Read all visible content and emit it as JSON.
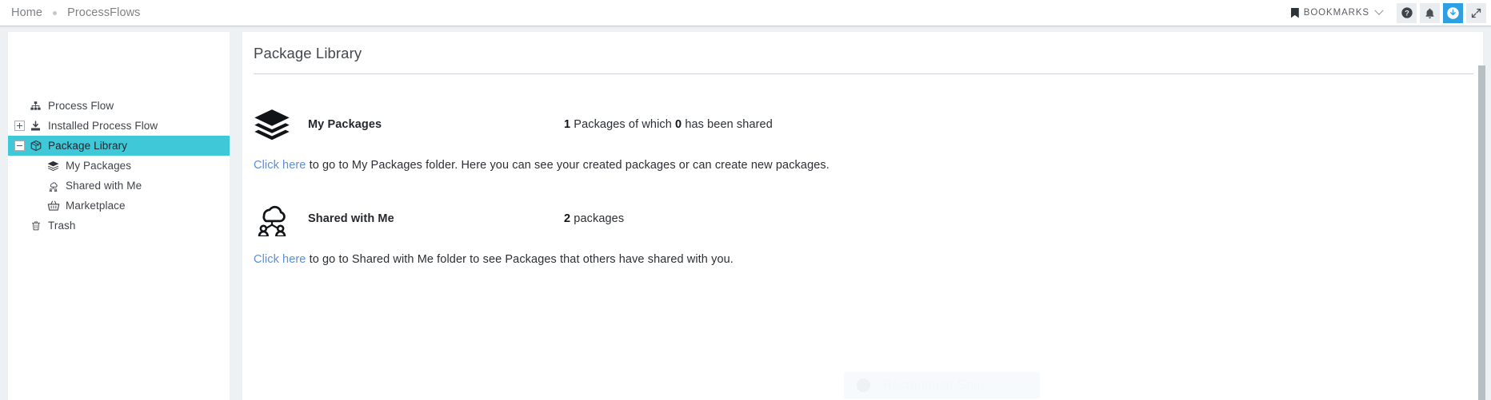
{
  "topbar": {
    "breadcrumb": [
      {
        "label": "Home"
      },
      {
        "label": "ProcessFlows"
      }
    ],
    "bookmarks_label": "BOOKMARKS",
    "buttons": [
      {
        "name": "help-button",
        "icon": "help-icon",
        "active": false
      },
      {
        "name": "notifications-button",
        "icon": "bell-icon",
        "active": false
      },
      {
        "name": "downloads-button",
        "icon": "download-circle-icon",
        "active": true
      },
      {
        "name": "fullscreen-button",
        "icon": "expand-arrows-icon",
        "active": false
      }
    ],
    "accent_color": "#2e9fe0",
    "button_bg": "#eaedf0"
  },
  "sidebar": {
    "highlight_color": "#3ec8d8",
    "items": [
      {
        "label": "Process Flow",
        "icon": "sitemap-icon",
        "toggle": "none",
        "level": 1,
        "selected": false
      },
      {
        "label": "Installed Process Flow",
        "icon": "install-icon",
        "toggle": "plus",
        "level": 1,
        "selected": false
      },
      {
        "label": "Package Library",
        "icon": "package-box-icon",
        "toggle": "minus",
        "level": 1,
        "selected": true
      },
      {
        "label": "My Packages",
        "icon": "layers-icon",
        "toggle": "none",
        "level": 2,
        "selected": false
      },
      {
        "label": "Shared with Me",
        "icon": "cloud-share-icon",
        "toggle": "none",
        "level": 2,
        "selected": false
      },
      {
        "label": "Marketplace",
        "icon": "basket-icon",
        "toggle": "none",
        "level": 2,
        "selected": false
      },
      {
        "label": "Trash",
        "icon": "trash-icon",
        "toggle": "none",
        "level": 1,
        "selected": false
      }
    ]
  },
  "main": {
    "title": "Package Library",
    "sections": [
      {
        "id": "my-packages",
        "icon": "layers-stack-icon",
        "name": "My Packages",
        "stat_count": "1",
        "stat_mid": " Packages of which ",
        "stat_count2": "0",
        "stat_tail": " has been shared",
        "link_text": "Click here",
        "desc_text": " to go to My Packages folder. Here you can see your created packages or can create new packages."
      },
      {
        "id": "shared-with-me",
        "icon": "cloud-users-icon",
        "name": "Shared with Me",
        "stat_count": "2",
        "stat_mid": " packages",
        "stat_count2": "",
        "stat_tail": "",
        "link_text": "Click here",
        "desc_text": " to go to Shared with Me folder to see Packages that others have shared with you."
      }
    ],
    "link_color": "#5b8fd6"
  },
  "overlay": {
    "snip_label": "Rectangular Snip"
  }
}
